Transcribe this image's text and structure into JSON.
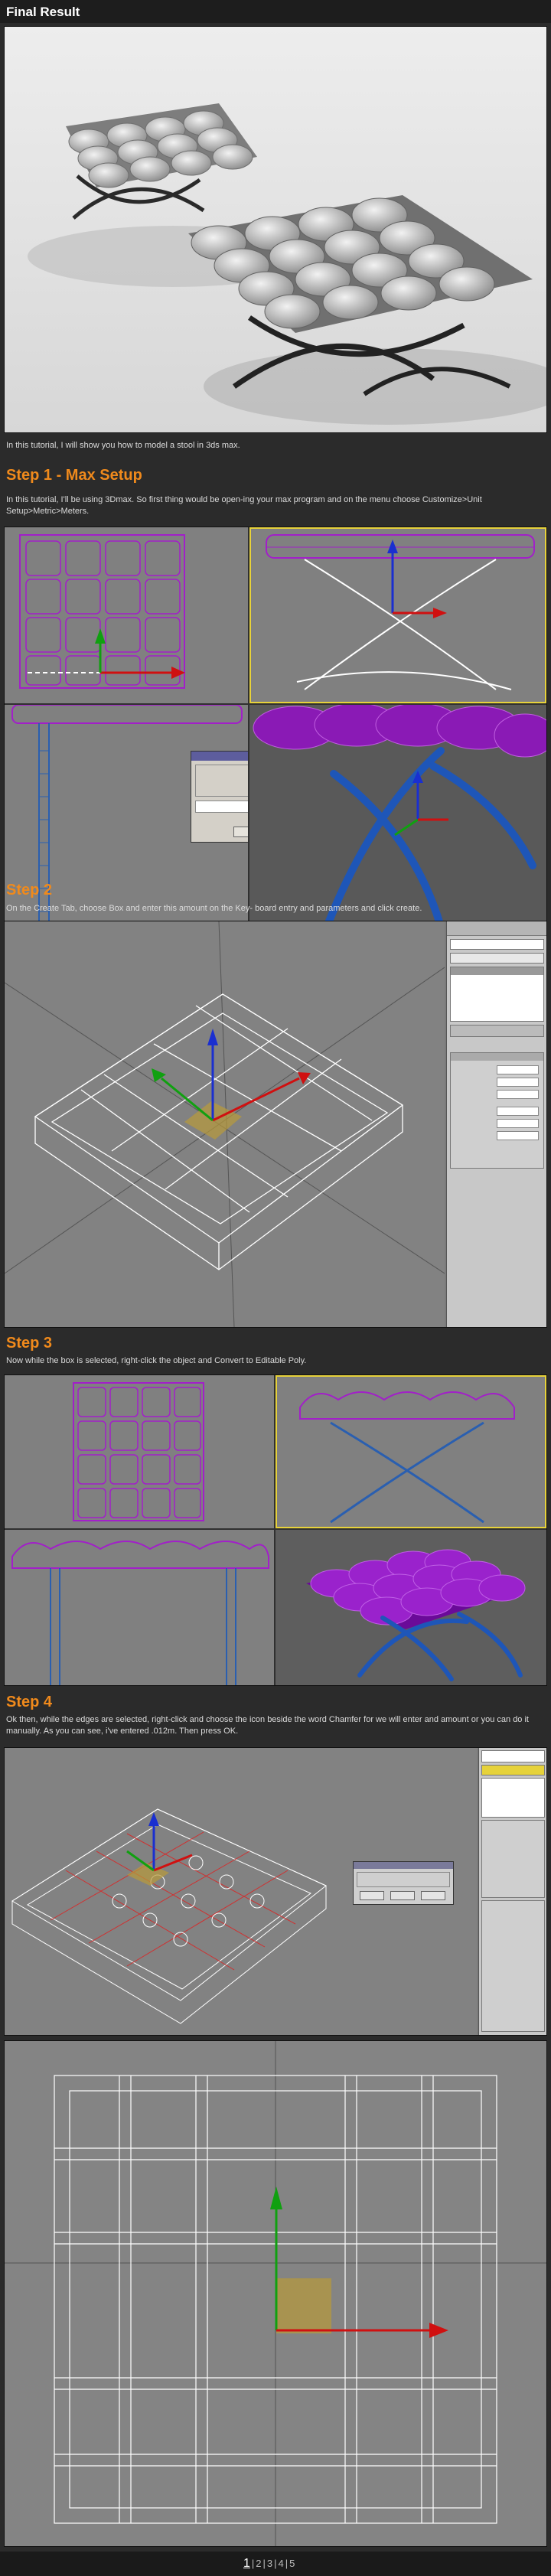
{
  "final": {
    "title": "Final Result",
    "intro": "In this tutorial, I will show you how to model a stool in 3ds max."
  },
  "step1": {
    "title": "Step 1 - Max Setup",
    "text": "In this tutorial, I'll be using 3Dmax. So first thing would be open-ing your max program and on the menu choose Customize>Unit Setup>Metric>Meters."
  },
  "step2": {
    "title": "Step 2",
    "text": "On the Create Tab, choose Box and enter this amount on the Key- board entry and parameters and click create."
  },
  "step3": {
    "title": "Step 3",
    "text": "Now while the box is selected, right-click the object and Convert to Editable Poly."
  },
  "step4": {
    "title": "Step 4",
    "text": "Ok then, while the edges are selected, right-click and choose the icon beside the word Chamfer for we will enter and amount or you can do it manually. As you can see, i've entered .012m. Then press OK."
  },
  "pager": {
    "pages": [
      "1",
      "2",
      "3",
      "4",
      "5"
    ],
    "active": "1"
  },
  "colors": {
    "accent": "#f08a1c",
    "purple": "#a21fc9",
    "blue_leg": "#2a5fb0"
  }
}
